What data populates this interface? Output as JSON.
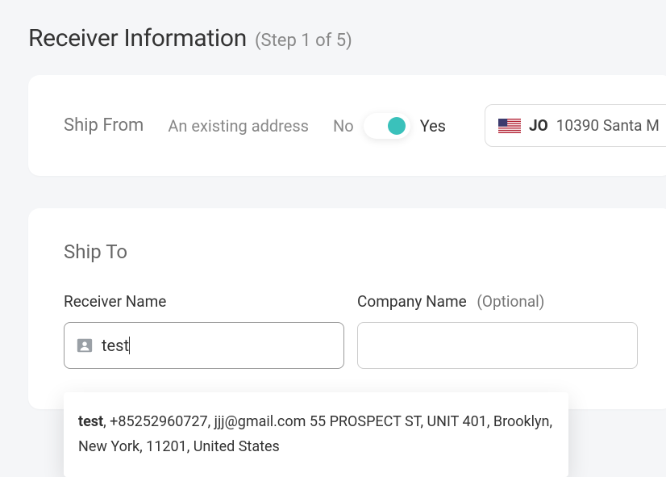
{
  "header": {
    "title": "Receiver Information",
    "step": "(Step 1 of 5)"
  },
  "shipFrom": {
    "label": "Ship From",
    "existingText": "An existing address",
    "noLabel": "No",
    "yesLabel": "Yes",
    "addressCode": "JO",
    "addressText": "10390 Santa M"
  },
  "shipTo": {
    "label": "Ship To",
    "receiverName": {
      "label": "Receiver Name",
      "value": "test"
    },
    "companyName": {
      "label": "Company Name",
      "optional": "(Optional)",
      "value": ""
    },
    "suggestion": {
      "name": "test",
      "rest": ", +85252960727, jjj@gmail.com 55 PROSPECT ST, UNIT 401, Brooklyn, New York, 11201, United States"
    }
  }
}
